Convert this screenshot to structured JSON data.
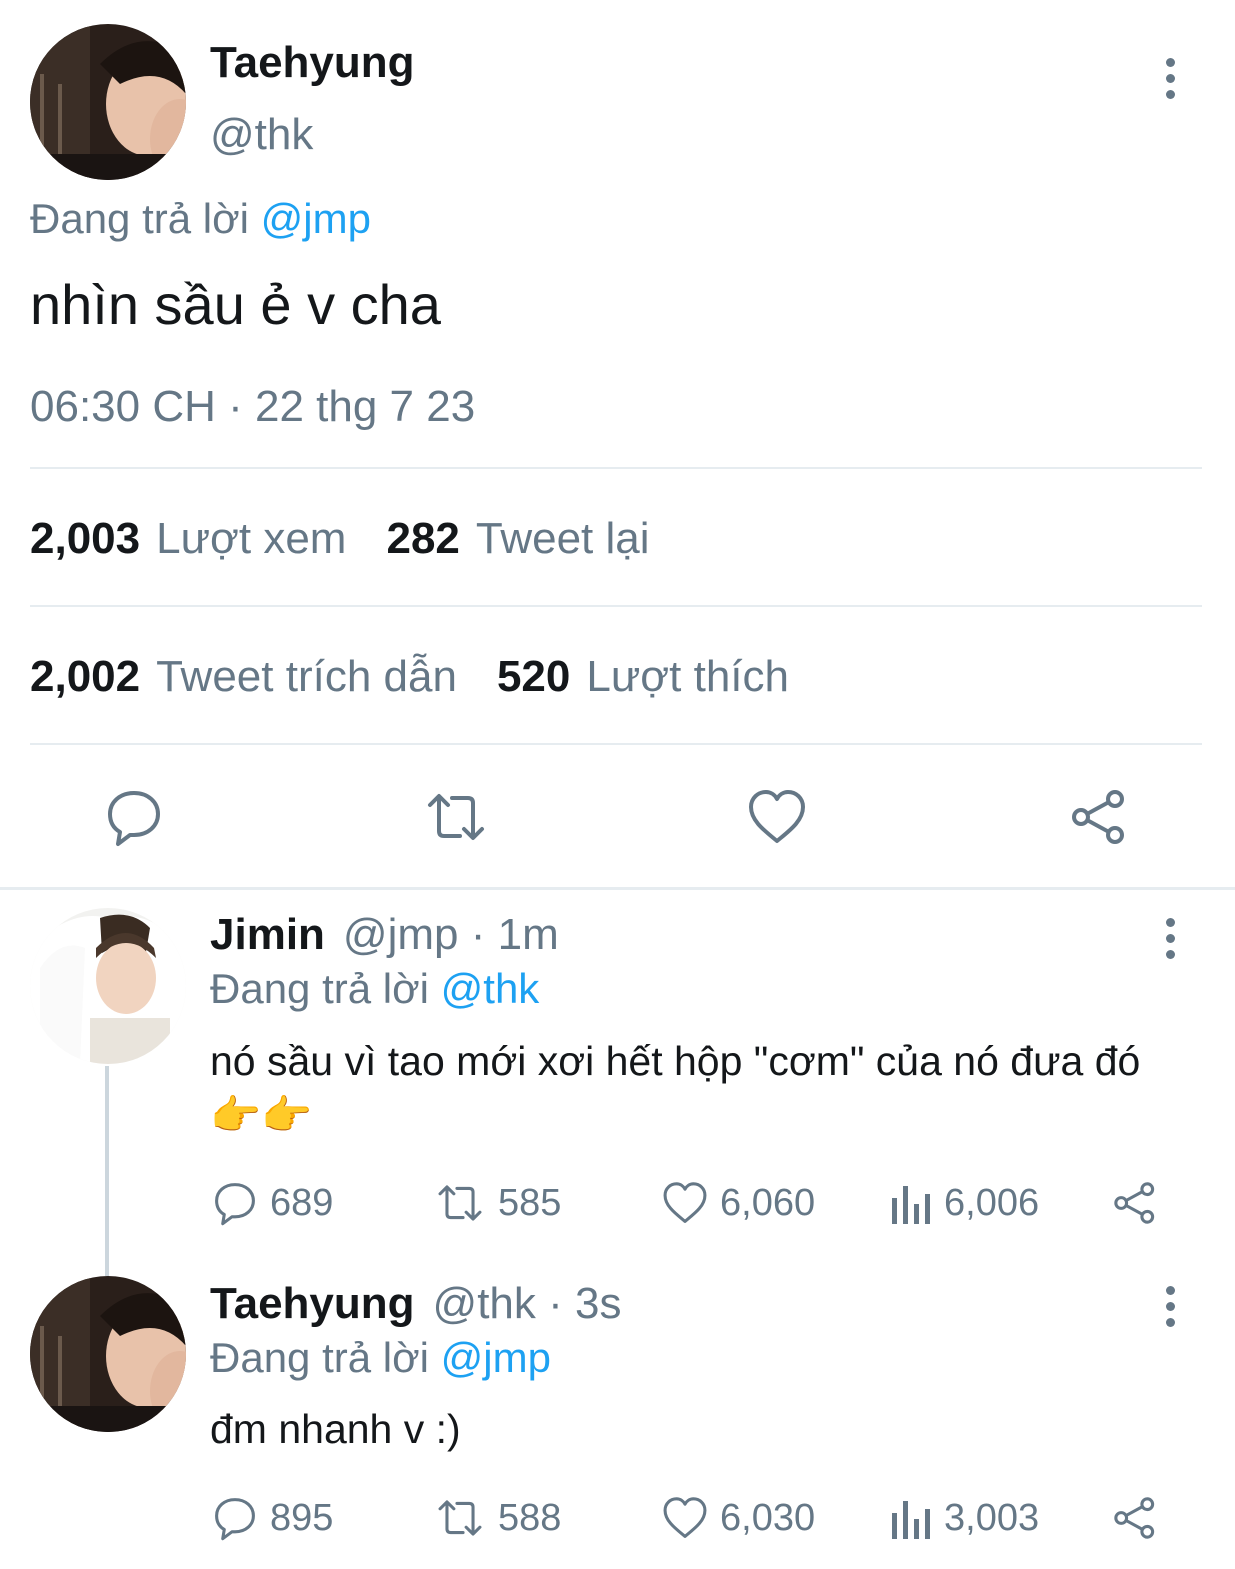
{
  "main_tweet": {
    "name": "Taehyung",
    "handle": "@thk",
    "replying_prefix": "Đang trả lời",
    "replying_to": "@jmp",
    "text": "nhìn sầu ẻ v cha",
    "timestamp": "06:30 CH · 22 thg 7 23",
    "stats": {
      "views_count": "2,003",
      "views_label": "Lượt xem",
      "retweets_count": "282",
      "retweets_label": "Tweet lại",
      "quotes_count": "2,002",
      "quotes_label": "Tweet trích dẫn",
      "likes_count": "520",
      "likes_label": "Lượt thích"
    },
    "actions": [
      "reply-icon",
      "retweet-icon",
      "heart-icon",
      "share-icon"
    ]
  },
  "replies": [
    {
      "name": "Jimin",
      "handle": "@jmp",
      "time": "· 1m",
      "replying_prefix": "Đang trả lời",
      "replying_to": "@thk",
      "text": "nó sầu vì tao mới xơi hết hộp \"cơm\" của nó đưa đó👉👉",
      "reply_count": "689",
      "retweet_count": "585",
      "like_count": "6,060",
      "view_count": "6,006"
    },
    {
      "name": "Taehyung",
      "handle": "@thk",
      "time": "· 3s",
      "replying_prefix": "Đang trả lời",
      "replying_to": "@jmp",
      "text": "đm nhanh v :)",
      "reply_count": "895",
      "retweet_count": "588",
      "like_count": "6,030",
      "view_count": "3,003"
    }
  ],
  "colors": {
    "text": "#14171a",
    "muted": "#657786",
    "link": "#1da1f2",
    "divider": "#e6ecf0",
    "thread_line": "#ccd6dd"
  }
}
